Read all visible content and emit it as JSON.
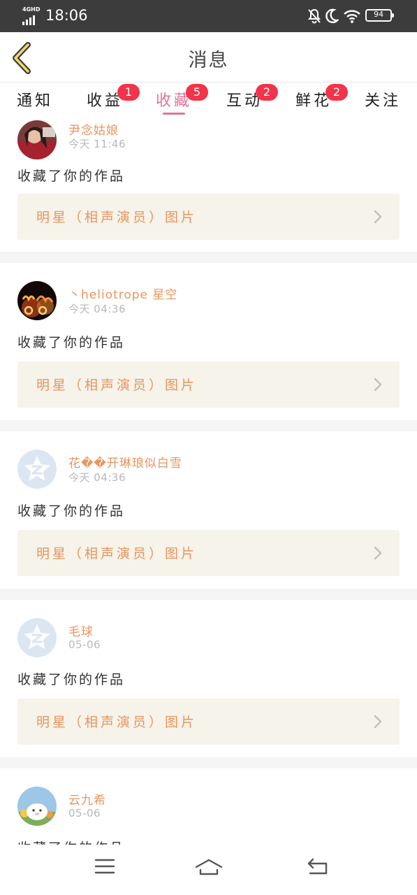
{
  "status_bar": {
    "network": "4GHD",
    "time": "18:06",
    "battery": "94",
    "icons": [
      "signal-icon",
      "mute-bell-icon",
      "moon-icon",
      "wifi-icon",
      "battery-icon"
    ]
  },
  "nav": {
    "title": "消息",
    "back_icon": "chevron-left-icon"
  },
  "tabs": [
    {
      "label": "通知",
      "badge": ""
    },
    {
      "label": "收益",
      "badge": "1"
    },
    {
      "label": "收藏",
      "badge": "5",
      "active": true
    },
    {
      "label": "互动",
      "badge": "2"
    },
    {
      "label": "鲜花",
      "badge": "2"
    },
    {
      "label": "关注",
      "badge": ""
    }
  ],
  "colors": {
    "accent_tab": "#e0739c",
    "username": "#e8955f",
    "badge": "#f2334a",
    "work_box_bg": "#f5f3ea"
  },
  "feed": [
    {
      "user": "尹念姑娘",
      "time": "今天 11:46",
      "action": "收藏了你的作品",
      "work": "明星（相声演员）图片"
    },
    {
      "user": "丶heliotrope 星空",
      "time": "今天 04:36",
      "action": "收藏了你的作品",
      "work": "明星（相声演员）图片"
    },
    {
      "user": "花��开琳琅似白雪",
      "time": "今天 04:36",
      "action": "收藏了你的作品",
      "work": "明星（相声演员）图片"
    },
    {
      "user": "毛球",
      "time": "05-06",
      "action": "收藏了你的作品",
      "work": "明星（相声演员）图片"
    },
    {
      "user": "云九希",
      "time": "05-06",
      "action": "收藏了你的作品",
      "work": ""
    }
  ],
  "bottom_nav": [
    "menu-icon",
    "home-icon",
    "back-icon"
  ]
}
